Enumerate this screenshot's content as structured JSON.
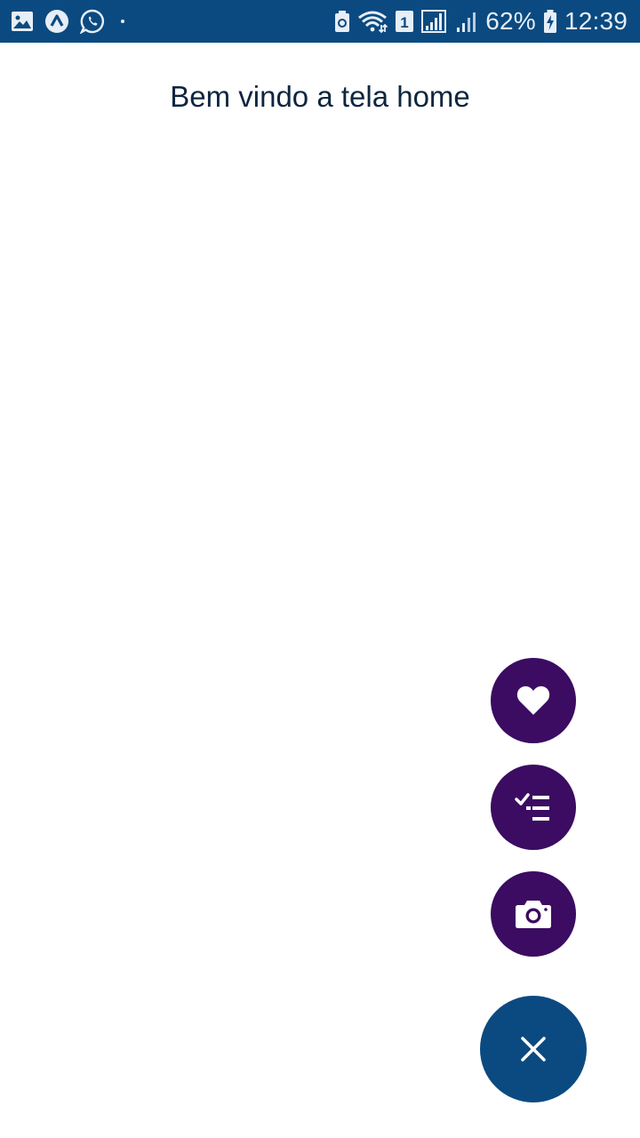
{
  "status_bar": {
    "battery_percent": "62%",
    "time": "12:39",
    "sim_slot": "1",
    "left_icons": [
      "gallery-icon",
      "app-a-icon",
      "whatsapp-icon",
      "dot-icon"
    ],
    "right_icons": [
      "battery-saver-icon",
      "wifi-icon",
      "sim-1-icon",
      "signal-1-icon",
      "signal-2-icon",
      "battery-charging-icon"
    ],
    "background": "#0b4a80"
  },
  "main": {
    "welcome_text": "Bem vindo a tela home"
  },
  "fab_menu": {
    "actions": [
      {
        "name": "favorite",
        "icon": "heart-icon"
      },
      {
        "name": "checklist",
        "icon": "checklist-icon"
      },
      {
        "name": "camera",
        "icon": "camera-icon"
      }
    ],
    "main_icon": "close-icon",
    "action_color": "#3b0c62",
    "main_color": "#0b4a80"
  }
}
